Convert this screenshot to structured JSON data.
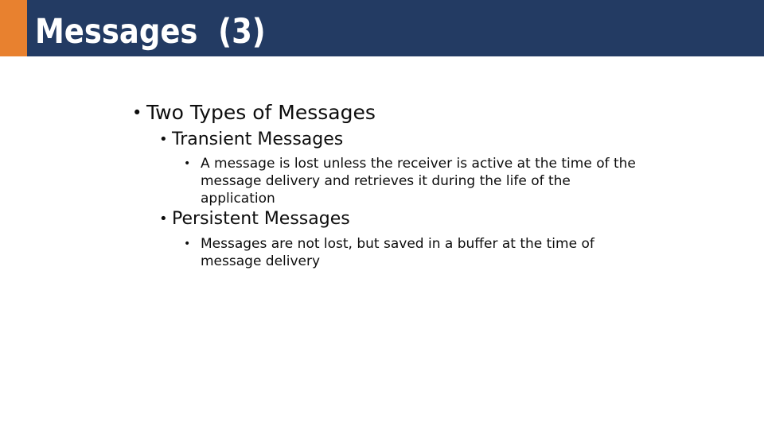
{
  "slide": {
    "title": "Messages  (3)",
    "colors": {
      "header_navy": "#233b63",
      "accent_orange": "#e8812f",
      "background": "#ffffff",
      "body_text": "#0d0d0d",
      "title_text": "#ffffff"
    },
    "bullet_glyph": "•",
    "outline": {
      "level1": {
        "text": "Two Types of Messages"
      },
      "transient": {
        "heading": "Transient Messages",
        "detail": "A message is lost unless the receiver is active at the time of the message delivery and retrieves it during the life of the application"
      },
      "persistent": {
        "heading": "Persistent Messages",
        "detail": "Messages are not lost, but saved in a buffer at the time of message delivery"
      }
    }
  }
}
